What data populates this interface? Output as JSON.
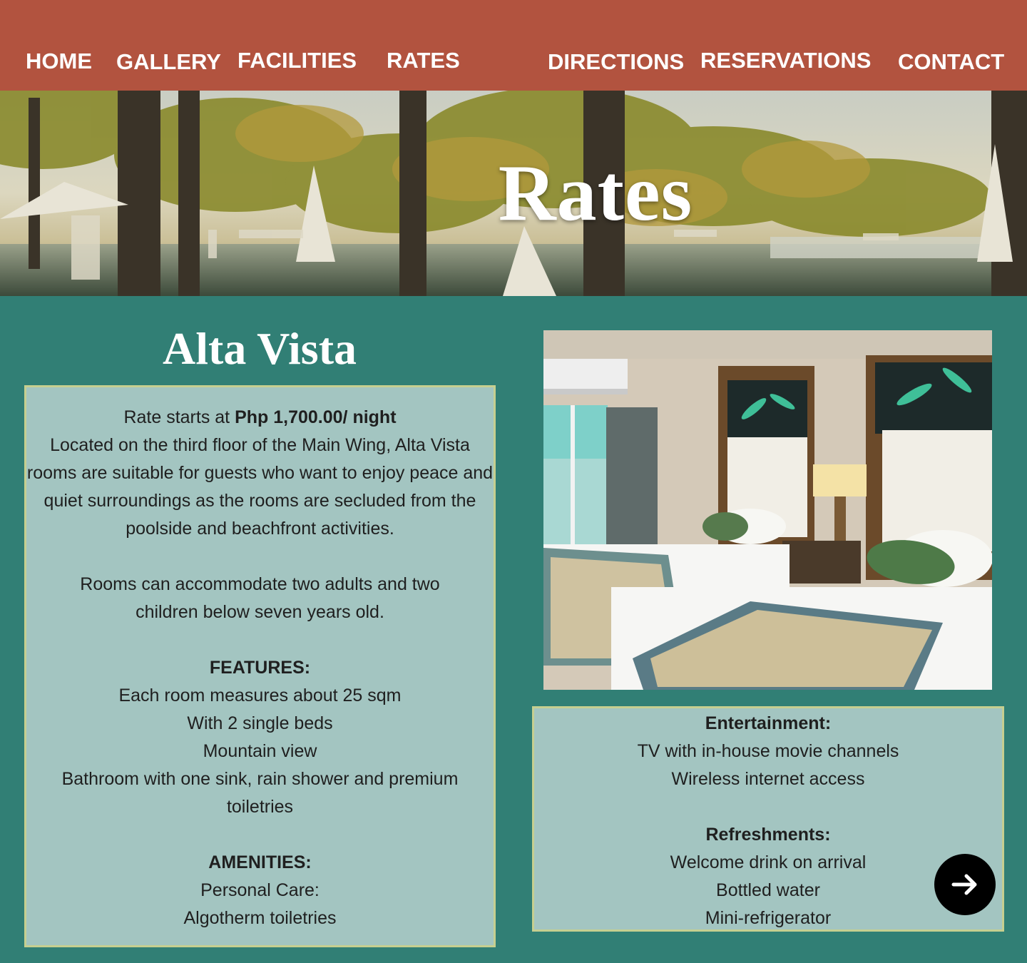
{
  "nav": {
    "home": "HOME",
    "gallery": "GALLERY",
    "facilities": "FACILITIES",
    "rates": "RATES",
    "directions": "DIRECTIONS",
    "reservations": "RESERVATIONS",
    "contact": "CONTACT"
  },
  "hero": {
    "title": "Rates"
  },
  "room": {
    "name": "Alta Vista",
    "rate_prefix": "Rate starts at ",
    "rate_value": "Php 1,700.00/ night",
    "description": "Located on the third floor of the Main Wing, Alta Vista rooms are suitable for guests who want to enjoy peace and quiet surroundings as the rooms are secluded from the poolside and beachfront activities.",
    "capacity": "Rooms can accommodate two adults and two children below seven years old.",
    "features_heading": "FEATURES:",
    "features": [
      "Each room measures about 25 sqm",
      "With 2 single beds",
      "Mountain view",
      "Bathroom with one sink, rain shower and premium toiletries"
    ],
    "amenities_heading": "AMENITIES:",
    "personal_care_heading": "Personal Care:",
    "personal_care": [
      "Algotherm toiletries"
    ],
    "entertainment_heading": "Entertainment:",
    "entertainment": [
      "TV with in-house movie channels",
      "Wireless internet access"
    ],
    "refreshments_heading": "Refreshments:",
    "refreshments": [
      "Welcome drink on arrival",
      "Bottled water",
      "Mini-refrigerator"
    ]
  },
  "colors": {
    "nav_bg": "#b2533f",
    "page_bg": "#317f75",
    "box_bg": "#a3c5c1",
    "box_border": "#c6cf90"
  },
  "icons": {
    "next": "arrow-right-icon"
  }
}
